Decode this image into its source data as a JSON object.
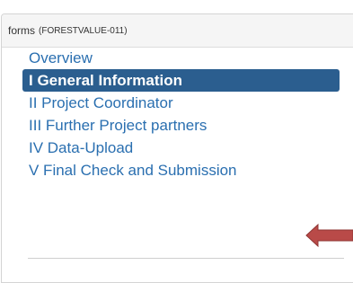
{
  "panel": {
    "header_title": "forms",
    "header_code": "(FORESTVALUE-011)"
  },
  "nav": {
    "items": [
      {
        "label": "Overview",
        "active": false
      },
      {
        "label": "I General Information",
        "active": true
      },
      {
        "label": "II Project Coordinator",
        "active": false
      },
      {
        "label": "III Further Project partners",
        "active": false
      },
      {
        "label": "IV Data-Upload",
        "active": false
      },
      {
        "label": "V Final Check and Submission",
        "active": false
      }
    ]
  },
  "colors": {
    "link": "#2a6fb0",
    "active_bg": "#2b5e8f",
    "arrow": "#b94a48"
  },
  "annotation": {
    "icon": "left-arrow-icon"
  }
}
